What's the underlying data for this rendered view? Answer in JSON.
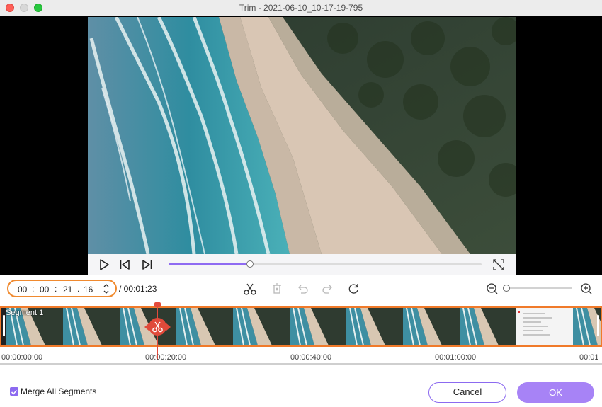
{
  "window": {
    "title": "Trim - 2021-06-10_10-17-19-795"
  },
  "player": {
    "progress_fraction": 0.26
  },
  "time_input": {
    "hours": "00",
    "minutes": "00",
    "seconds": "21",
    "frames": "16",
    "sep1": ":",
    "sep2": ":",
    "sep3": ".",
    "duration": "/ 00:01:23"
  },
  "timeline": {
    "segment_label": "Segment 1",
    "ruler": [
      "00:00:00:00",
      "00:00:20:00",
      "00:00:40:00",
      "00:01:00:00",
      "00:01"
    ]
  },
  "footer": {
    "merge_label": "Merge All Segments",
    "merge_checked": true,
    "cancel_label": "Cancel",
    "ok_label": "OK"
  },
  "colors": {
    "accent": "#8c6af0",
    "highlight": "#f08a2f",
    "playhead": "#e24a3b"
  },
  "icons": [
    "play-icon",
    "previous-frame-icon",
    "next-frame-icon",
    "fullscreen-icon",
    "scissors-icon",
    "delete-icon",
    "undo-icon",
    "redo-icon",
    "reset-icon",
    "zoom-out-icon",
    "zoom-in-icon",
    "checkmark-icon"
  ]
}
